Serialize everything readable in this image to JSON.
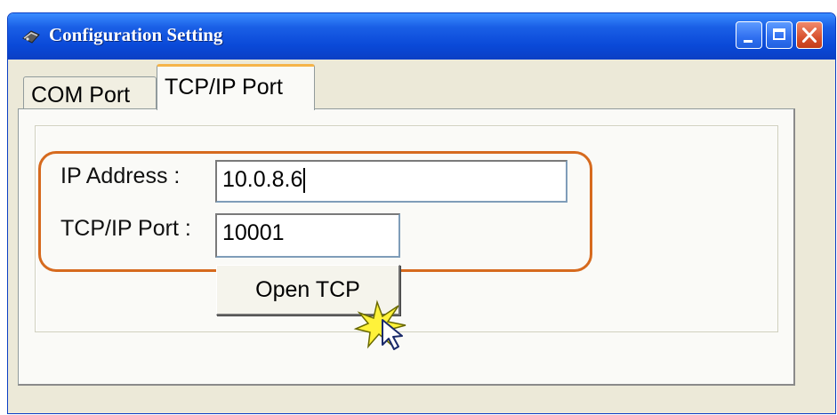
{
  "window": {
    "title": "Configuration Setting",
    "controls": {
      "minimize": "minimize-icon",
      "maximize": "maximize-icon",
      "close": "close-icon"
    },
    "colors": {
      "titlebar": "#0a49d8",
      "body": "#ece9d8",
      "highlight_outline": "#d66a1e",
      "close_button": "#d8512e"
    }
  },
  "tabs": [
    {
      "label": "COM Port",
      "selected": false
    },
    {
      "label": "TCP/IP Port",
      "selected": true
    }
  ],
  "form": {
    "ip_address": {
      "label": "IP Address :",
      "value": "10.0.8.6"
    },
    "tcp_port": {
      "label": "TCP/IP Port :",
      "value": "10001"
    },
    "open_button": {
      "label": "Open TCP"
    }
  }
}
